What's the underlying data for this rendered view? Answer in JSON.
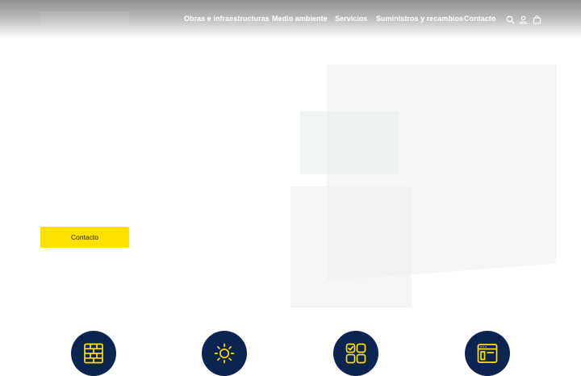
{
  "header": {
    "nav": [
      {
        "label": "Obras e infraestructuras"
      },
      {
        "label": "Medio ambiente"
      },
      {
        "label": "Servicios"
      },
      {
        "label": "Suministros y recambios"
      },
      {
        "label": "Contacto"
      }
    ],
    "icons": [
      "search-icon",
      "user-icon",
      "cart-icon"
    ]
  },
  "hero": {
    "cta_label": "Contacto"
  },
  "features": {
    "icons": [
      "brick-wall-icon",
      "sun-icon",
      "apps-grid-icon",
      "browser-window-icon"
    ]
  },
  "colors": {
    "accent": "#ffe100",
    "feature_circle": "#0b2450",
    "icon_stroke": "#ffe100"
  }
}
